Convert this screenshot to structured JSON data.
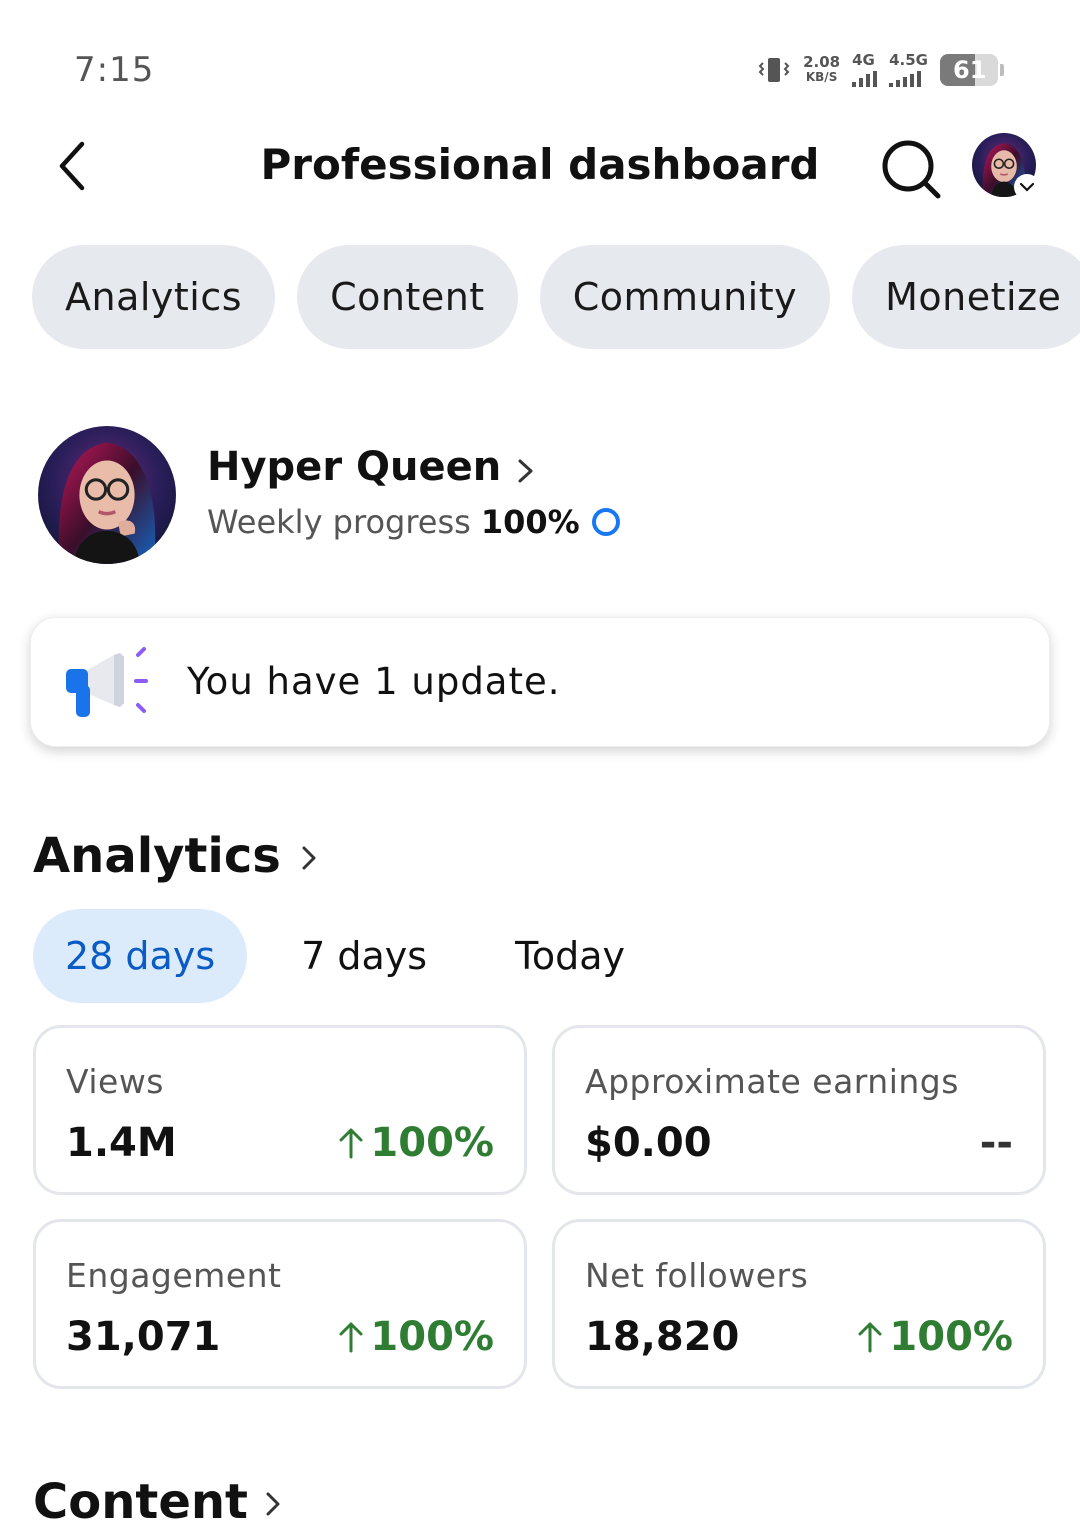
{
  "status_bar": {
    "time": "7:15",
    "net_speed_value": "2.08",
    "net_speed_unit": "KB/S",
    "network_1": "4G",
    "network_2": "4.5G",
    "battery_level": "61",
    "battery_fraction": 0.61
  },
  "header": {
    "title": "Professional dashboard",
    "back_icon": "chevron-left-icon",
    "search_icon": "search-icon",
    "account_switch_icon": "chevron-down-icon"
  },
  "tabs": [
    {
      "label": "Analytics"
    },
    {
      "label": "Content"
    },
    {
      "label": "Community"
    },
    {
      "label": "Monetize"
    }
  ],
  "profile": {
    "name": "Hyper Queen",
    "progress_label": "Weekly progress",
    "progress_value": "100%"
  },
  "update": {
    "icon": "megaphone-icon",
    "text": "You have 1 update."
  },
  "analytics": {
    "title": "Analytics",
    "ranges": [
      {
        "label": "28 days",
        "selected": true
      },
      {
        "label": "7 days",
        "selected": false
      },
      {
        "label": "Today",
        "selected": false
      }
    ],
    "metrics": [
      {
        "label": "Views",
        "value": "1.4M",
        "change": "100%",
        "trend": "up"
      },
      {
        "label": "Approximate earnings",
        "value": "$0.00",
        "change": "--",
        "trend": "none"
      },
      {
        "label": "Engagement",
        "value": "31,071",
        "change": "100%",
        "trend": "up"
      },
      {
        "label": "Net followers",
        "value": "18,820",
        "change": "100%",
        "trend": "up"
      }
    ]
  },
  "content_section": {
    "title": "Content"
  },
  "colors": {
    "accent_blue": "#1877f2",
    "selected_range_bg": "#dcebfb",
    "selected_range_text": "#0a5bc4",
    "positive_green": "#2e7d32",
    "pill_bg": "#e6e9ee"
  }
}
